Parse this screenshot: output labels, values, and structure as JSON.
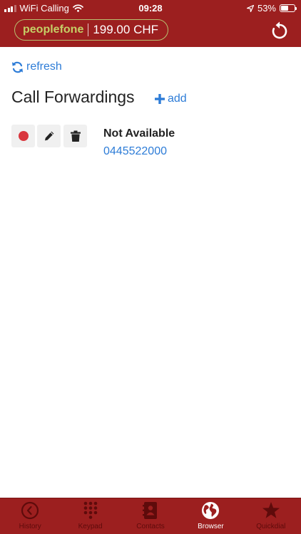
{
  "status_bar": {
    "carrier": "WiFi Calling",
    "time": "09:28",
    "battery": "53%",
    "battery_level": 0.53
  },
  "header": {
    "brand": "peoplefone",
    "balance": "199.00 CHF",
    "reload_icon": "reload-icon"
  },
  "toolbar": {
    "refresh_label": "refresh",
    "add_label": "add"
  },
  "page": {
    "title": "Call Forwardings"
  },
  "forwardings": [
    {
      "name": "Not Available",
      "number": "0445522000",
      "status_color": "#d9363e"
    }
  ],
  "tabs": [
    {
      "label": "History",
      "icon": "clock-icon",
      "active": false
    },
    {
      "label": "Keypad",
      "icon": "keypad-icon",
      "active": false
    },
    {
      "label": "Contacts",
      "icon": "contacts-icon",
      "active": false
    },
    {
      "label": "Browser",
      "icon": "globe-icon",
      "active": true
    },
    {
      "label": "Quickdial",
      "icon": "star-icon",
      "active": false
    }
  ],
  "colors": {
    "brand_red": "#9c1f1f",
    "link_blue": "#2d7cd7",
    "brand_green": "#c5cf66",
    "tab_inactive": "#5e0b0b"
  }
}
